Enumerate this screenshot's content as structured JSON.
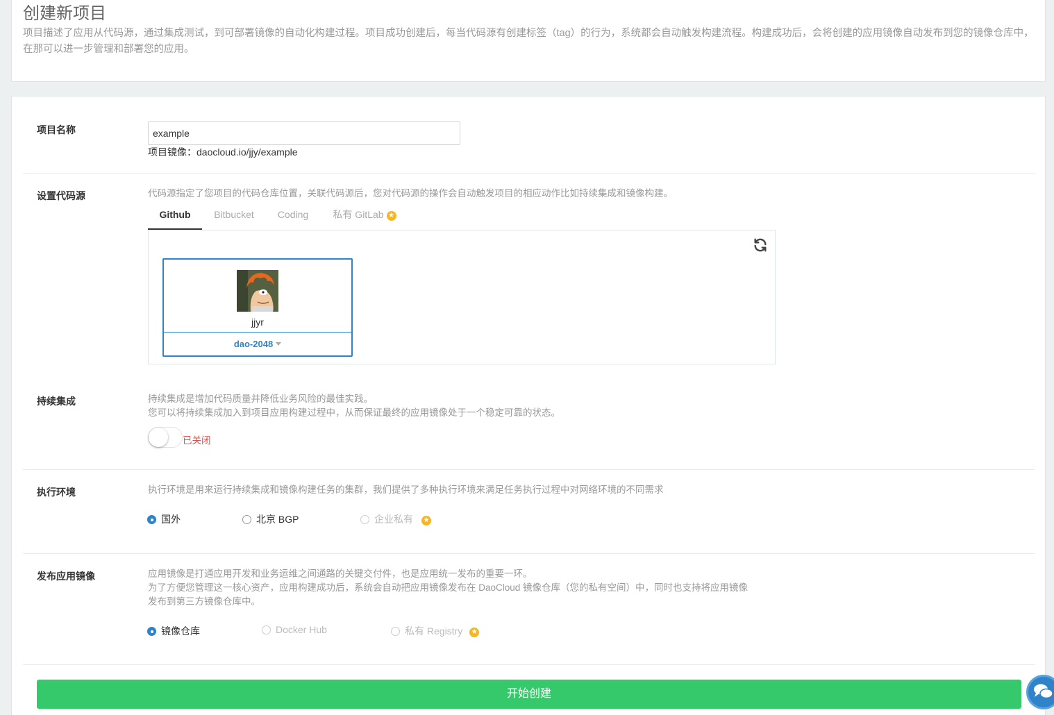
{
  "header": {
    "title": "创建新项目",
    "description": "项目描述了应用从代码源，通过集成测试，到可部署镜像的自动化构建过程。项目成功创建后，每当代码源有创建标签（tag）的行为，系统都会自动触发构建流程。构建成功后，会将创建的应用镜像自动发布到您的镜像仓库中，在那可以进一步管理和部署您的应用。"
  },
  "project_name": {
    "label": "项目名称",
    "value": "example",
    "image_prefix": "项目镜像：",
    "image_path": "daocloud.io/jjy/example"
  },
  "code_source": {
    "label": "设置代码源",
    "help": "代码源指定了您项目的代码仓库位置，关联代码源后，您对代码源的操作会自动触发项目的相应动作比如持续集成和镜像构建。",
    "tabs": [
      {
        "label": "Github",
        "active": true
      },
      {
        "label": "Bitbucket",
        "active": false
      },
      {
        "label": "Coding",
        "active": false
      },
      {
        "label": "私有 GitLab",
        "active": false,
        "premium": true
      }
    ],
    "account": {
      "name": "jjyr",
      "org": "dao-2048"
    }
  },
  "ci": {
    "label": "持续集成",
    "help_line1": "持续集成是增加代码质量并降低业务风险的最佳实践。",
    "help_line2": "您可以将持续集成加入到项目应用构建过程中，从而保证最终的应用镜像处于一个稳定可靠的状态。",
    "status": "已关闭",
    "enabled": false
  },
  "env": {
    "label": "执行环境",
    "help": "执行环境是用来运行持续集成和镜像构建任务的集群，我们提供了多种执行环境来满足任务执行过程中对网络环境的不同需求",
    "options": [
      {
        "label": "国外",
        "checked": true
      },
      {
        "label": "北京 BGP",
        "checked": false
      },
      {
        "label": "企业私有",
        "checked": false,
        "disabled": true,
        "premium": true
      }
    ]
  },
  "publish": {
    "label": "发布应用镜像",
    "help_line1": "应用镜像是打通应用开发和业务运维之间通路的关键交付件，也是应用统一发布的重要一环。",
    "help_line2": "为了方便您管理这一核心资产，应用构建成功后，系统会自动把应用镜像发布在 DaoCloud 镜像仓库（您的私有空间）中，同时也支持将应用镜像",
    "help_line3": "发布到第三方镜像仓库中。",
    "options": [
      {
        "label": "镜像仓库",
        "checked": true
      },
      {
        "label": "Docker Hub",
        "checked": false,
        "disabled": true
      },
      {
        "label": "私有 Registry",
        "checked": false,
        "disabled": true,
        "premium": true
      }
    ]
  },
  "submit_label": "开始创建",
  "colors": {
    "primary": "#2f83c8",
    "success": "#36c96b",
    "danger": "#d9534f",
    "premium": "#f5b723"
  }
}
